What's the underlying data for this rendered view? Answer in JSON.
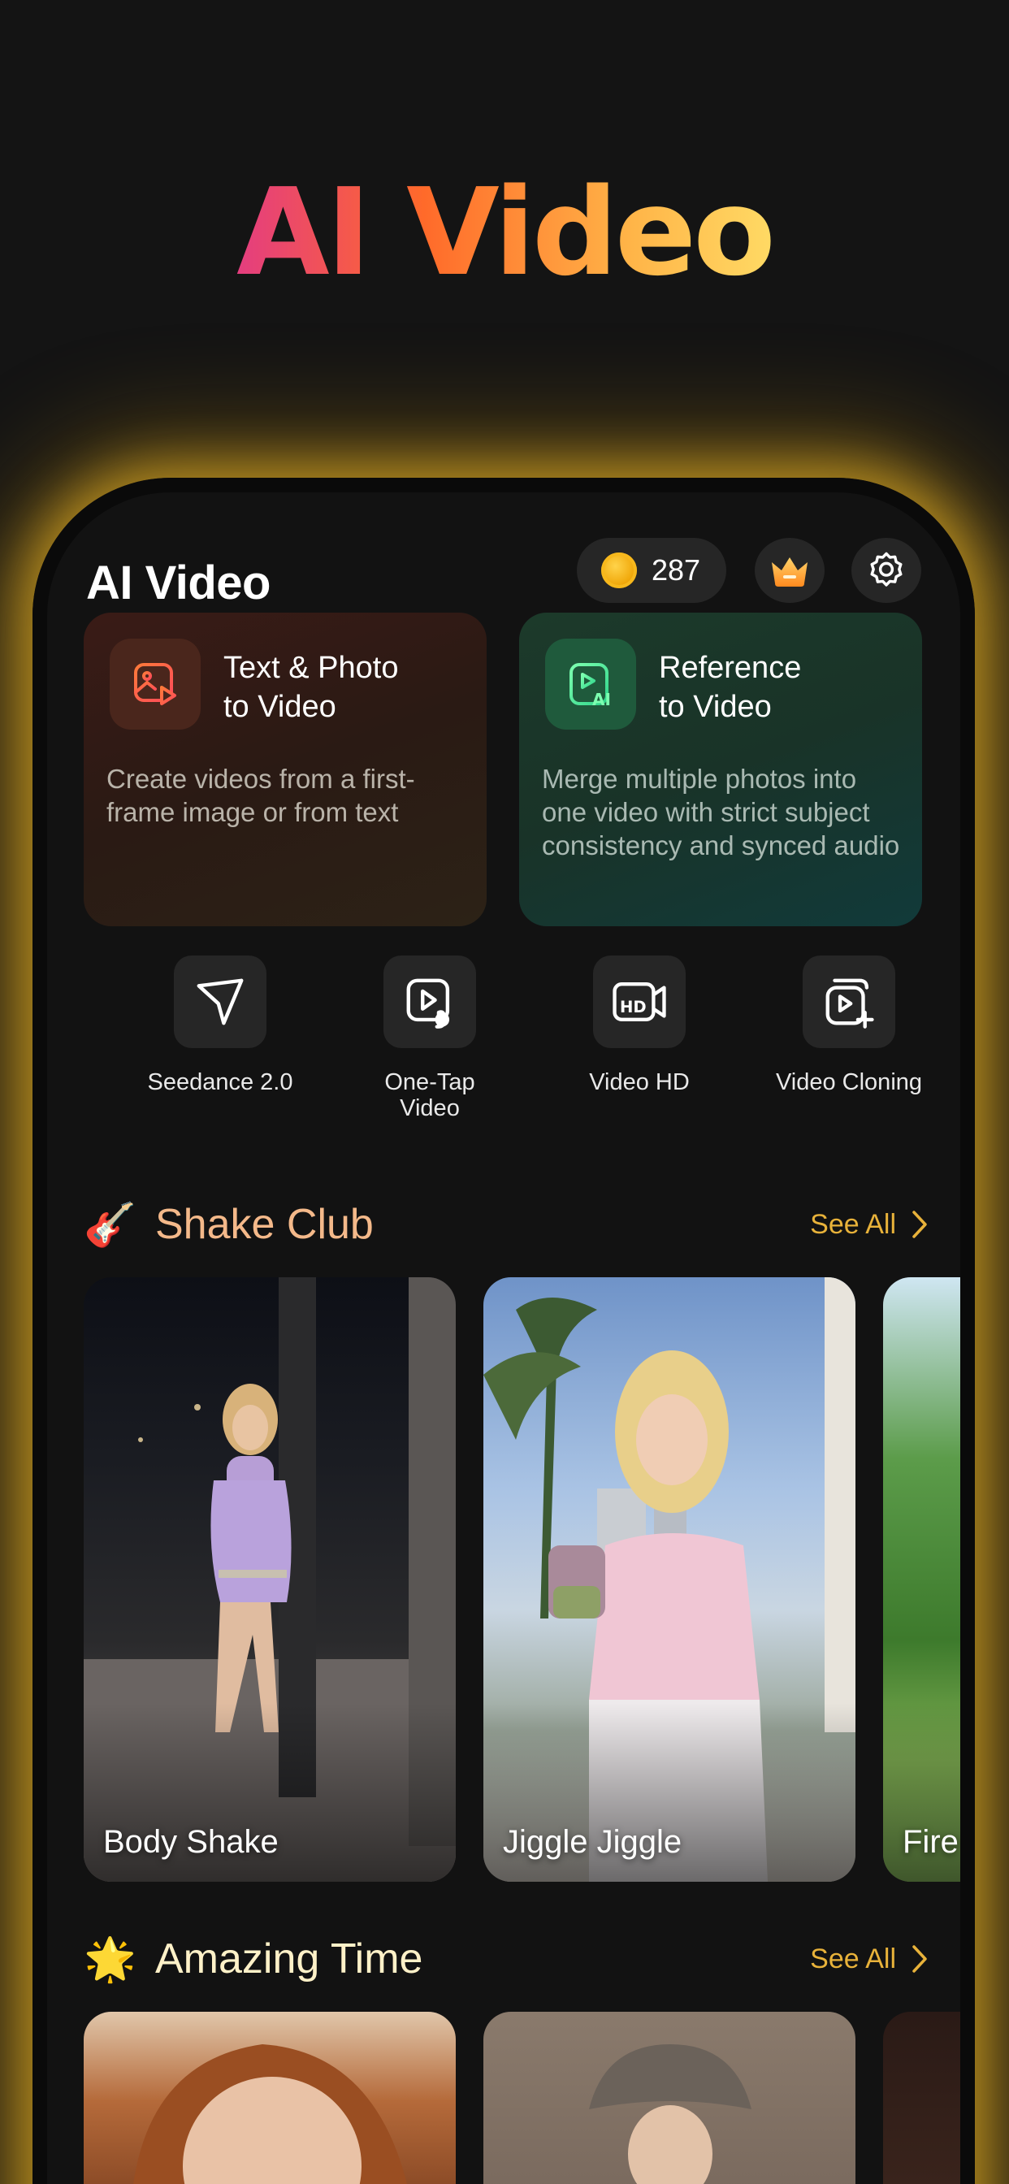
{
  "hero": {
    "title": "AI Video"
  },
  "header": {
    "title": "AI Video",
    "coins": "287"
  },
  "cards": [
    {
      "title_line1": "Text & Photo",
      "title_line2": "to Video",
      "description": "Create videos from a first-frame image or from text",
      "icon": "image-play-icon"
    },
    {
      "title_line1": "Reference",
      "title_line2": "to Video",
      "description": "Merge multiple photos into one video with strict subject consistency and synced audio",
      "icon": "video-ai-icon"
    }
  ],
  "tools": [
    {
      "label": "Seedance 2.0",
      "icon": "paper-plane-icon"
    },
    {
      "label_line1": "One-Tap",
      "label_line2": "Video",
      "icon": "video-tap-icon"
    },
    {
      "label": "Video HD",
      "icon": "hd-camera-icon"
    },
    {
      "label": "Video Cloning",
      "icon": "video-clone-icon"
    }
  ],
  "sections": [
    {
      "emoji": "🎸",
      "title": "Shake Club",
      "see_all": "See All",
      "items": [
        {
          "label": "Body Shake"
        },
        {
          "label": "Jiggle Jiggle"
        },
        {
          "label": "Fire"
        }
      ]
    },
    {
      "emoji": "🌟",
      "title": "Amazing Time",
      "see_all": "See All",
      "items": [
        {
          "label": ""
        },
        {
          "label": ""
        },
        {
          "label": ""
        }
      ]
    }
  ],
  "colors": {
    "background": "#141414",
    "accent_gold": "#e8b23a",
    "shake_club_title": "#f4b98a",
    "amazing_time_title": "#fff1c8",
    "glow": "#ffc428"
  }
}
